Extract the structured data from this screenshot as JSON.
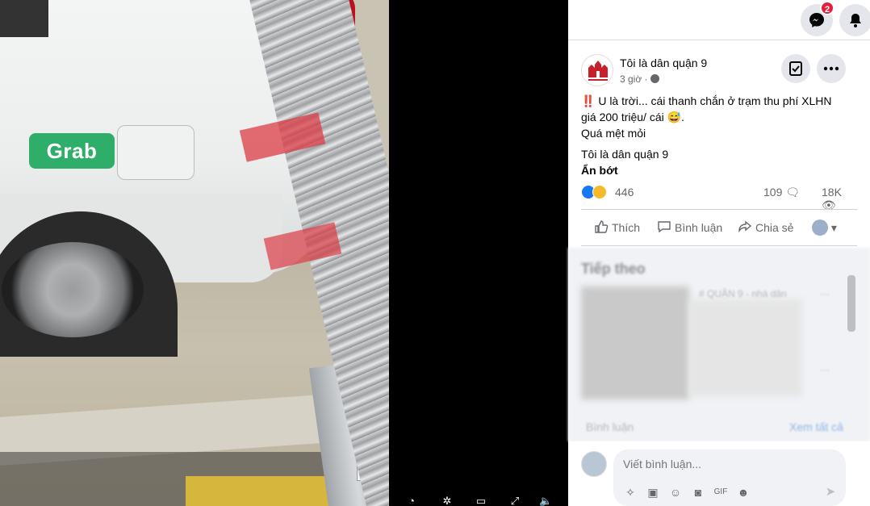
{
  "topbar": {
    "messenger_badge": "2"
  },
  "post": {
    "page_name": "Tôi là dân quận 9",
    "time": "3 giờ ·",
    "text_line1": "‼️ U là trời... cái thanh chắn ở trạm thu phí XLHN",
    "text_line2": "giá 200 triệu/ cái 😅.",
    "text_line3": "Quá mệt mỏi",
    "page_tag": "Tôi là dân quận 9",
    "see_less": "Ẩn bớt",
    "reaction_count": "446",
    "comment_count": "109",
    "view_count": "18K",
    "actions": {
      "like": "Thích",
      "comment": "Bình luận",
      "share": "Chia sẻ"
    }
  },
  "next_section": {
    "title": "Tiếp theo",
    "blurred_caption": "# QUẬN 9 - nhà dân",
    "comments_label": "Bình luận",
    "see_all": "Xem tất cả"
  },
  "composer": {
    "placeholder": "Viết bình luận..."
  },
  "video": {
    "brand_badge": "Grab"
  },
  "colors": {
    "facebook_blue": "#1877f2",
    "notif_red": "#e41e3f",
    "grab_green": "#2fae6a"
  }
}
